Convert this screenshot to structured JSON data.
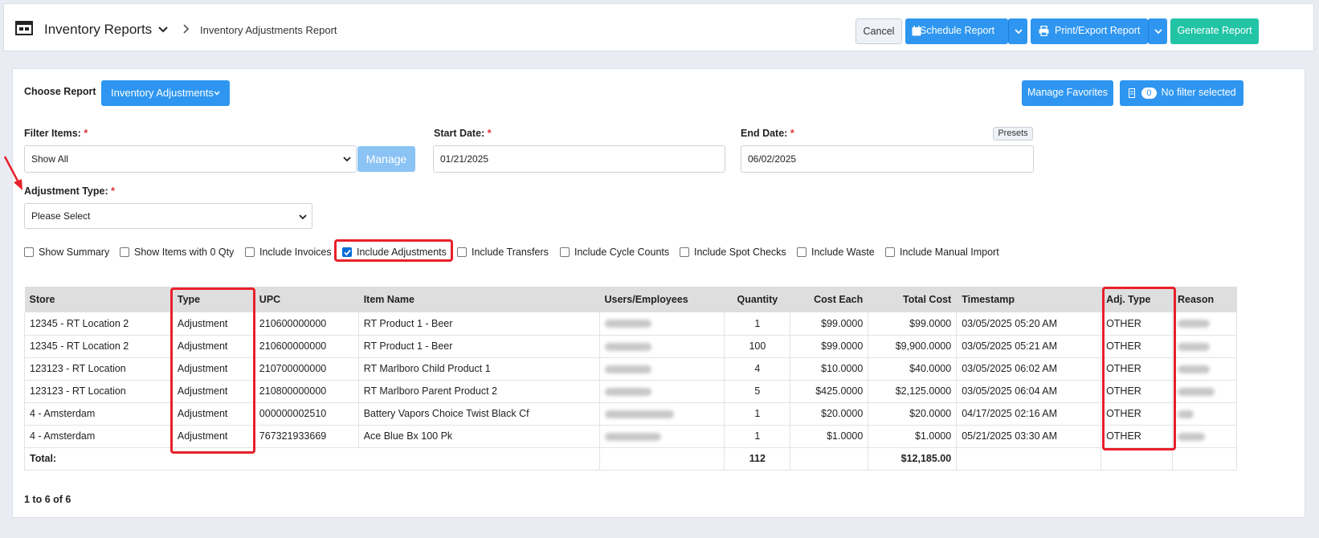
{
  "header": {
    "app_title": "Inventory Reports",
    "breadcrumb": "Inventory Adjustments Report",
    "buttons": {
      "cancel": "Cancel",
      "schedule": "Schedule Report",
      "print_export": "Print/Export Report",
      "generate": "Generate Report"
    }
  },
  "controls": {
    "choose_report_label": "Choose Report",
    "choose_report_value": "Inventory Adjustments",
    "manage_favorites": "Manage Favorites",
    "filter_count": "0",
    "no_filter": "No filter selected"
  },
  "filters": {
    "filter_items_label": "Filter Items:",
    "filter_items_value": "Show All",
    "manage_button": "Manage",
    "start_date_label": "Start Date:",
    "start_date_value": "01/21/2025",
    "end_date_label": "End Date:",
    "end_date_value": "06/02/2025",
    "presets": "Presets",
    "adjustment_type_label": "Adjustment Type:",
    "adjustment_type_value": "Please Select",
    "required_mark": "*"
  },
  "checkboxes": [
    {
      "label": "Show Summary",
      "checked": false
    },
    {
      "label": "Show Items with 0 Qty",
      "checked": false
    },
    {
      "label": "Include Invoices",
      "checked": false
    },
    {
      "label": "Include Adjustments",
      "checked": true
    },
    {
      "label": "Include Transfers",
      "checked": false
    },
    {
      "label": "Include Cycle Counts",
      "checked": false
    },
    {
      "label": "Include Spot Checks",
      "checked": false
    },
    {
      "label": "Include Waste",
      "checked": false
    },
    {
      "label": "Include Manual Import",
      "checked": false
    }
  ],
  "table": {
    "columns": [
      "Store",
      "Type",
      "UPC",
      "Item Name",
      "Users/Employees",
      "Quantity",
      "Cost Each",
      "Total Cost",
      "Timestamp",
      "Adj. Type",
      "Reason"
    ],
    "rows": [
      [
        "12345 - RT Location 2",
        "Adjustment",
        "210600000000",
        "RT Product 1 - Beer",
        "",
        "1",
        "$99.0000",
        "$99.0000",
        "03/05/2025 05:20 AM",
        "OTHER",
        ""
      ],
      [
        "12345 - RT Location 2",
        "Adjustment",
        "210600000000",
        "RT Product 1 - Beer",
        "",
        "100",
        "$99.0000",
        "$9,900.0000",
        "03/05/2025 05:21 AM",
        "OTHER",
        ""
      ],
      [
        "123123 - RT Location",
        "Adjustment",
        "210700000000",
        "RT Marlboro Child Product 1",
        "",
        "4",
        "$10.0000",
        "$40.0000",
        "03/05/2025 06:02 AM",
        "OTHER",
        ""
      ],
      [
        "123123 - RT Location",
        "Adjustment",
        "210800000000",
        "RT Marlboro Parent Product 2",
        "",
        "5",
        "$425.0000",
        "$2,125.0000",
        "03/05/2025 06:04 AM",
        "OTHER",
        ""
      ],
      [
        "4 - Amsterdam",
        "Adjustment",
        "000000002510",
        "Battery Vapors Choice Twist Black Cf",
        "",
        "1",
        "$20.0000",
        "$20.0000",
        "04/17/2025 02:16 AM",
        "OTHER",
        ""
      ],
      [
        "4 - Amsterdam",
        "Adjustment",
        "767321933669",
        "Ace Blue Bx 100 Pk",
        "",
        "1",
        "$1.0000",
        "$1.0000",
        "05/21/2025 03:30 AM",
        "OTHER",
        ""
      ]
    ],
    "total_label": "Total:",
    "total_quantity": "112",
    "total_cost": "$12,185.00"
  },
  "pagination": "1 to 6 of 6",
  "colors": {
    "primary": "#2e96f0",
    "generate": "#22c4a6",
    "highlight": "#e8202a"
  },
  "icons": [
    "warehouse-icon",
    "chevron-down-icon",
    "chevron-right-icon",
    "calendar-icon",
    "printer-icon",
    "filter-icon",
    "arrow-annotation-icon"
  ]
}
